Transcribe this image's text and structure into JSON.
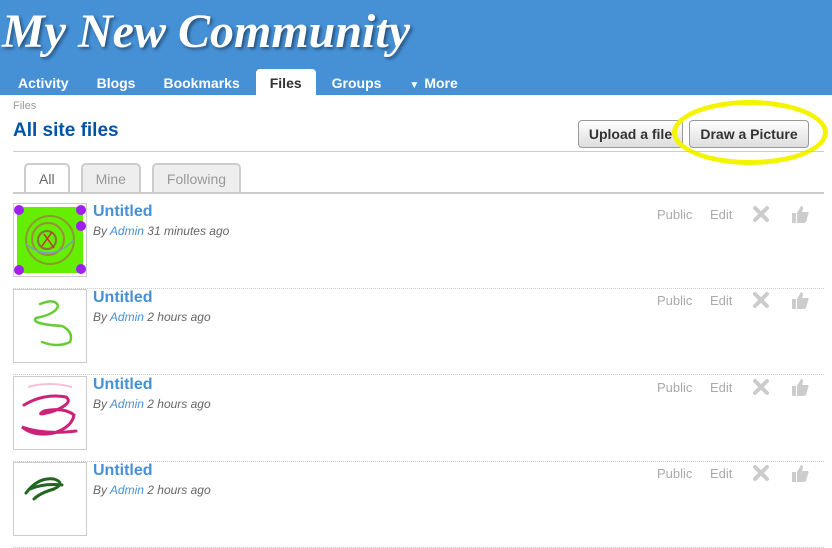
{
  "site": {
    "title": "My New Community"
  },
  "nav": [
    {
      "label": "Activity",
      "active": false
    },
    {
      "label": "Blogs",
      "active": false
    },
    {
      "label": "Bookmarks",
      "active": false
    },
    {
      "label": "Files",
      "active": true
    },
    {
      "label": "Groups",
      "active": false
    },
    {
      "label": "More",
      "active": false,
      "icon": "triangle-down-icon"
    }
  ],
  "breadcrumb": "Files",
  "page_title": "All site files",
  "buttons": {
    "upload": "Upload a file",
    "draw": "Draw a Picture"
  },
  "tabs": [
    {
      "label": "All",
      "active": true
    },
    {
      "label": "Mine",
      "active": false
    },
    {
      "label": "Following",
      "active": false
    }
  ],
  "files": [
    {
      "title": "Untitled",
      "by": "By",
      "author": "Admin",
      "time": "31 minutes ago",
      "access": "Public",
      "edit": "Edit",
      "thumb": "green-spiral-drawing"
    },
    {
      "title": "Untitled",
      "by": "By",
      "author": "Admin",
      "time": "2 hours ago",
      "access": "Public",
      "edit": "Edit",
      "thumb": "green-squiggle-drawing"
    },
    {
      "title": "Untitled",
      "by": "By",
      "author": "Admin",
      "time": "2 hours ago",
      "access": "Public",
      "edit": "Edit",
      "thumb": "pink-scribble-drawing"
    },
    {
      "title": "Untitled",
      "by": "By",
      "author": "Admin",
      "time": "2 hours ago",
      "access": "Public",
      "edit": "Edit",
      "thumb": "dark-green-scribble-drawing"
    }
  ],
  "colors": {
    "header": "#4690d6",
    "link": "#4690d6",
    "title": "#0054a7",
    "highlight": "#f4f400"
  }
}
